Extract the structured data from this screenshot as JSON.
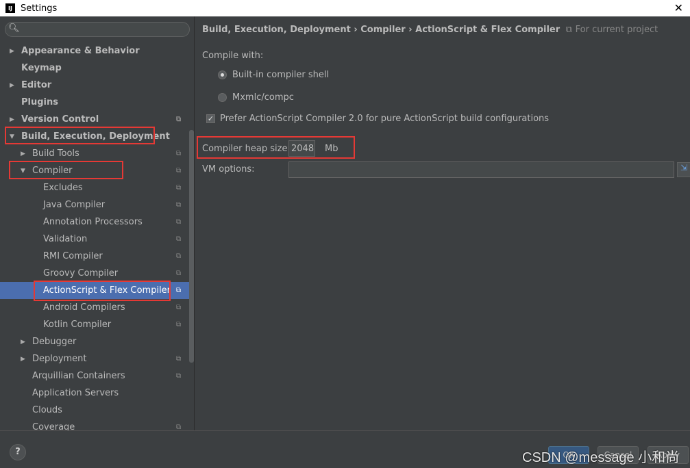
{
  "window": {
    "title": "Settings",
    "close": "✕"
  },
  "sidebar": {
    "items": [
      {
        "label": "Appearance & Behavior",
        "bold": true,
        "level": 0,
        "arrow": "▶",
        "copy": false
      },
      {
        "label": "Keymap",
        "bold": true,
        "level": 0,
        "arrow": "",
        "copy": false
      },
      {
        "label": "Editor",
        "bold": true,
        "level": 0,
        "arrow": "▶",
        "copy": false
      },
      {
        "label": "Plugins",
        "bold": true,
        "level": 0,
        "arrow": "",
        "copy": false
      },
      {
        "label": "Version Control",
        "bold": true,
        "level": 0,
        "arrow": "▶",
        "copy": true
      },
      {
        "label": "Build, Execution, Deployment",
        "bold": true,
        "level": 0,
        "arrow": "▼",
        "copy": false
      },
      {
        "label": "Build Tools",
        "level": 1,
        "arrow": "▶",
        "copy": true
      },
      {
        "label": "Compiler",
        "level": 1,
        "arrow": "▼",
        "copy": true
      },
      {
        "label": "Excludes",
        "level": 2,
        "arrow": "",
        "copy": true
      },
      {
        "label": "Java Compiler",
        "level": 2,
        "arrow": "",
        "copy": true
      },
      {
        "label": "Annotation Processors",
        "level": 2,
        "arrow": "",
        "copy": true
      },
      {
        "label": "Validation",
        "level": 2,
        "arrow": "",
        "copy": true
      },
      {
        "label": "RMI Compiler",
        "level": 2,
        "arrow": "",
        "copy": true
      },
      {
        "label": "Groovy Compiler",
        "level": 2,
        "arrow": "",
        "copy": true
      },
      {
        "label": "ActionScript & Flex Compiler",
        "level": 2,
        "arrow": "",
        "copy": true,
        "selected": true
      },
      {
        "label": "Android Compilers",
        "level": 2,
        "arrow": "",
        "copy": true
      },
      {
        "label": "Kotlin Compiler",
        "level": 2,
        "arrow": "",
        "copy": true
      },
      {
        "label": "Debugger",
        "level": 1,
        "arrow": "▶",
        "copy": false
      },
      {
        "label": "Deployment",
        "level": 1,
        "arrow": "▶",
        "copy": true
      },
      {
        "label": "Arquillian Containers",
        "level": 1,
        "arrow": "",
        "copy": true
      },
      {
        "label": "Application Servers",
        "level": 1,
        "arrow": "",
        "copy": false
      },
      {
        "label": "Clouds",
        "level": 1,
        "arrow": "",
        "copy": false
      },
      {
        "label": "Coverage",
        "level": 1,
        "arrow": "",
        "copy": true
      }
    ]
  },
  "breadcrumb": {
    "parts": [
      "Build, Execution, Deployment",
      "Compiler",
      "ActionScript & Flex Compiler"
    ],
    "sep": "›",
    "project": "For current project"
  },
  "form": {
    "compile_with": "Compile with:",
    "option_builtin": "Built-in compiler shell",
    "option_mxmlc": "Mxmlc/compc",
    "selected": "Built-in compiler shell",
    "prefer_label": "Prefer ActionScript Compiler 2.0 for pure ActionScript build configurations",
    "prefer_checked": true,
    "heap_label": "Compiler heap size:",
    "heap_value": "2048",
    "heap_unit": "Mb",
    "vm_label": "VM options:",
    "vm_value": ""
  },
  "footer": {
    "help": "?",
    "ok": "OK",
    "cancel": "Cancel",
    "apply": "Apply",
    "watermark": "CSDN @message 小和尚"
  },
  "colors": {
    "selection": "#4b6eaf",
    "highlight": "#e53935",
    "background": "#3c3f41"
  }
}
